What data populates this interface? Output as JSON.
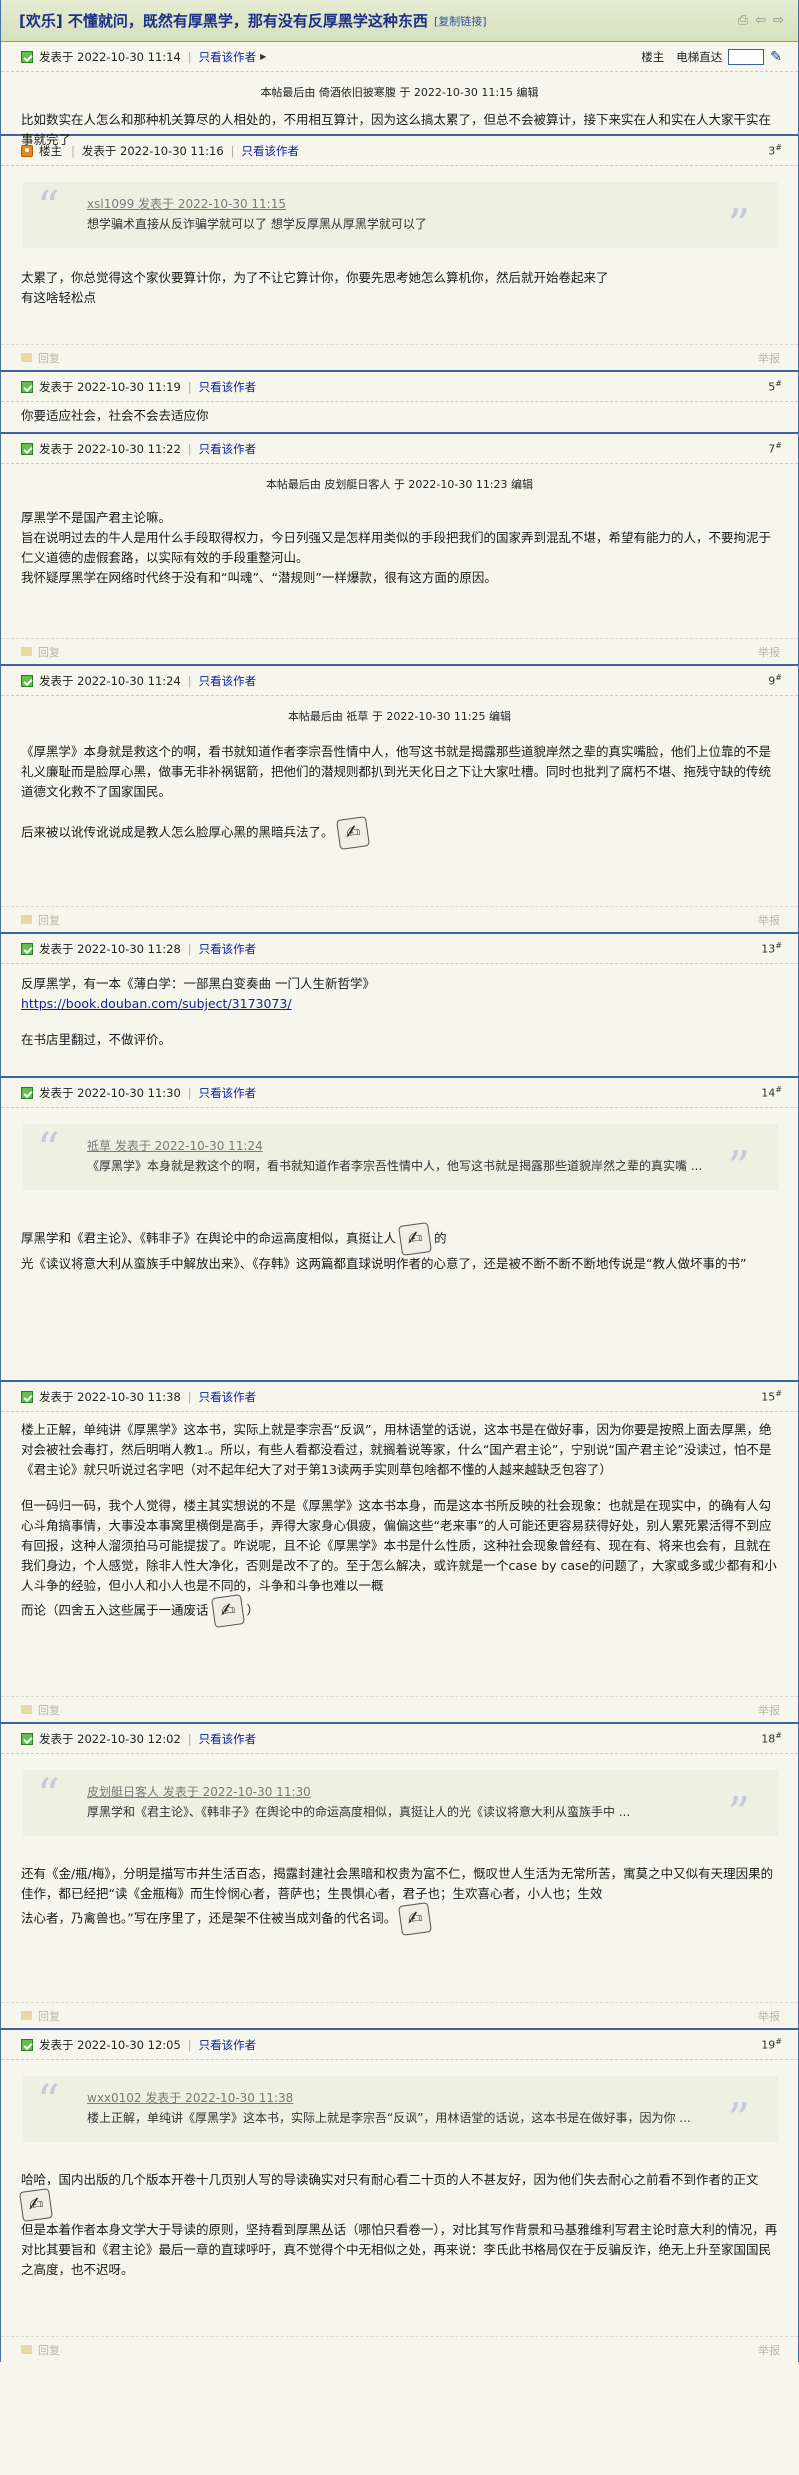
{
  "title": {
    "text": "[欢乐] 不懂就问，既然有厚黑学，那有没有反厚黑学这种东西",
    "copy_link": "[复制链接]"
  },
  "common": {
    "only_author": "只看该作者",
    "owner": "楼主",
    "reply": "回复",
    "report": "举报",
    "jump_label": "电梯直达"
  },
  "posts": [
    {
      "time": "发表于 2022-10-30 11:14",
      "edited": "本帖最后由 倚酒依旧披寒腹 于 2022-10-30 11:15 编辑",
      "body": [
        "比如数实在人怎么和那种机关算尽的人相处的，不用相互算计，因为这么搞太累了，但总不会被算计，接下来实在人和实在人大家干实在事就完了"
      ]
    },
    {
      "time": "发表于 2022-10-30 11:16",
      "floor": "3",
      "quote_head": "xsl1099 发表于 2022-10-30 11:15",
      "quote_text": "想学骗术直接从反诈骗学就可以了 想学反厚黑从厚黑学就可以了",
      "body": [
        "太累了，你总觉得这个家伙要算计你，为了不让它算计你，你要先思考她怎么算机你，然后就开始卷起来了",
        "有这啥轻松点"
      ]
    },
    {
      "time": "发表于 2022-10-30 11:19",
      "floor": "5",
      "body": [
        "你要适应社会，社会不会去适应你"
      ]
    },
    {
      "time": "发表于 2022-10-30 11:22",
      "floor": "7",
      "edited": "本帖最后由 皮划艇日客人 于 2022-10-30 11:23 编辑",
      "body": [
        "厚黑学不是国产君主论嘛。",
        "旨在说明过去的牛人是用什么手段取得权力，今日列强又是怎样用类似的手段把我们的国家弄到混乱不堪，希望有能力的人，不要拘泥于仁义道德的虚假套路，以实际有效的手段重整河山。",
        "我怀疑厚黑学在网络时代终于没有和“叫魂”、“潜规则”一样爆款，很有这方面的原因。"
      ]
    },
    {
      "time": "发表于 2022-10-30 11:24",
      "floor": "9",
      "edited": "本帖最后由 祗草 于 2022-10-30 11:25 编辑",
      "body": [
        "《厚黑学》本身就是救这个的啊，看书就知道作者李宗吾性情中人，他写这书就是揭露那些道貌岸然之辈的真实嘴脸，他们上位靠的不是礼义廉耻而是脸厚心黑，做事无非补祸锯箭，把他们的潜规则都扒到光天化日之下让大家吐槽。同时也批判了腐朽不堪、拖残守缺的传统道德文化救不了国家国民。"
      ],
      "body_last": "后来被以讹传讹说成是教人怎么脸厚心黑的黑暗兵法了。"
    },
    {
      "time": "发表于 2022-10-30 11:28",
      "floor": "13",
      "body": [
        "反厚黑学，有一本《薄白学：一部黑白变奏曲 一门人生新哲学》"
      ],
      "link": "https://book.douban.com/subject/3173073/",
      "body_after": "在书店里翻过，不做评价。"
    },
    {
      "time": "发表于 2022-10-30 11:30",
      "floor": "14",
      "quote_head": "祗草 发表于 2022-10-30 11:24",
      "quote_text": "《厚黑学》本身就是救这个的啊，看书就知道作者李宗吾性情中人，他写这书就是揭露那些道貌岸然之辈的真实嘴 ...",
      "body_a": "厚黑学和《君主论》、《韩非子》在舆论中的命运高度相似，真挺让人",
      "body_b": "的",
      "body_c": "光《读议将意大利从蛮族手中解放出来》、《存韩》这两篇都直球说明作者的心意了，还是被不断不断不断地传说是“教人做坏事的书”"
    },
    {
      "time": "发表于 2022-10-30 11:38",
      "floor": "15",
      "body": [
        "楼上正解，单纯讲《厚黑学》这本书，实际上就是李宗吾“反讽”，用林语堂的话说，这本书是在做好事，因为你要是按照上面去厚黑，绝对会被社会毒打，然后明哨人教1.。所以，有些人看都没看过，就搁着说等家，什么“国产君主论”，宁别说“国产君主论”没读过，怕不是《君主论》就只听说过名字吧（对不起年纪大了对于第13读两手实则草包啥都不懂的人越来越缺乏包容了）",
        "",
        "但一码归一码，我个人觉得，楼主其实想说的不是《厚黑学》这本书本身，而是这本书所反映的社会现象：也就是在现实中，的确有人勾心斗角搞事情，大事没本事窝里横倒是高手，弄得大家身心俱疲，偏偏这些“老来事”的人可能还更容易获得好处，别人累死累活得不到应有回报，这种人溜须拍马可能提拔了。咋说呢，且不论《厚黑学》本书是什么性质，这种社会现象曾经有、现在有、将来也会有，且就在我们身边，个人感觉，除非人性大净化，否则是改不了的。至于怎么解决，或许就是一个case by case的问题了，大家或多或少都有和小人斗争的经验，但小人和小人也是不同的，斗争和斗争也难以一概"
      ],
      "body_last_a": "而论（四舍五入这些属于一通废话",
      "body_last_b": "）"
    },
    {
      "time": "发表于 2022-10-30 12:02",
      "floor": "18",
      "quote_head": "皮划艇日客人 发表于 2022-10-30 11:30",
      "quote_text": "厚黑学和《君主论》、《韩非子》在舆论中的命运高度相似，真挺让人的光《读议将意大利从蛮族手中 ...",
      "body": [
        "还有《金/瓶/梅》，分明是描写市井生活百态，揭露封建社会黑暗和权贵为富不仁，慨叹世人生活为无常所苦，寓莫之中又似有天理因果的佳作，都已经把“读《金瓶梅》而生怜悯心者，菩萨也；生畏惧心者，君子也；生欢喜心者，小人也；生效"
      ],
      "body_last": "法心者，乃禽兽也。”写在序里了，还是架不住被当成刘备的代名词。"
    },
    {
      "time": "发表于 2022-10-30 12:05",
      "floor": "19",
      "quote_head": "wxx0102 发表于 2022-10-30 11:38",
      "quote_text": "楼上正解，单纯讲《厚黑学》这本书，实际上就是李宗吾“反讽”，用林语堂的话说，这本书是在做好事，因为你 ...",
      "body_a": "哈哈，国内出版的几个版本开卷十几页别人写的导读确实对只有耐心看二十页的人不甚友好，因为他们失去耐心之前看不到作者的正文",
      "body": [
        "但是本着作者本身文学大于导读的原则，坚持看到厚黑丛话（哪怕只看卷一），对比其写作背景和马基雅维利写君主论时意大利的情况，再对比其要旨和《君主论》最后一章的直球呼吁，真不觉得个中无相似之处，再来说：李氏此书格局仅在于反骗反诈，绝无上升至家国国民之高度，也不迟呀。"
      ]
    }
  ]
}
